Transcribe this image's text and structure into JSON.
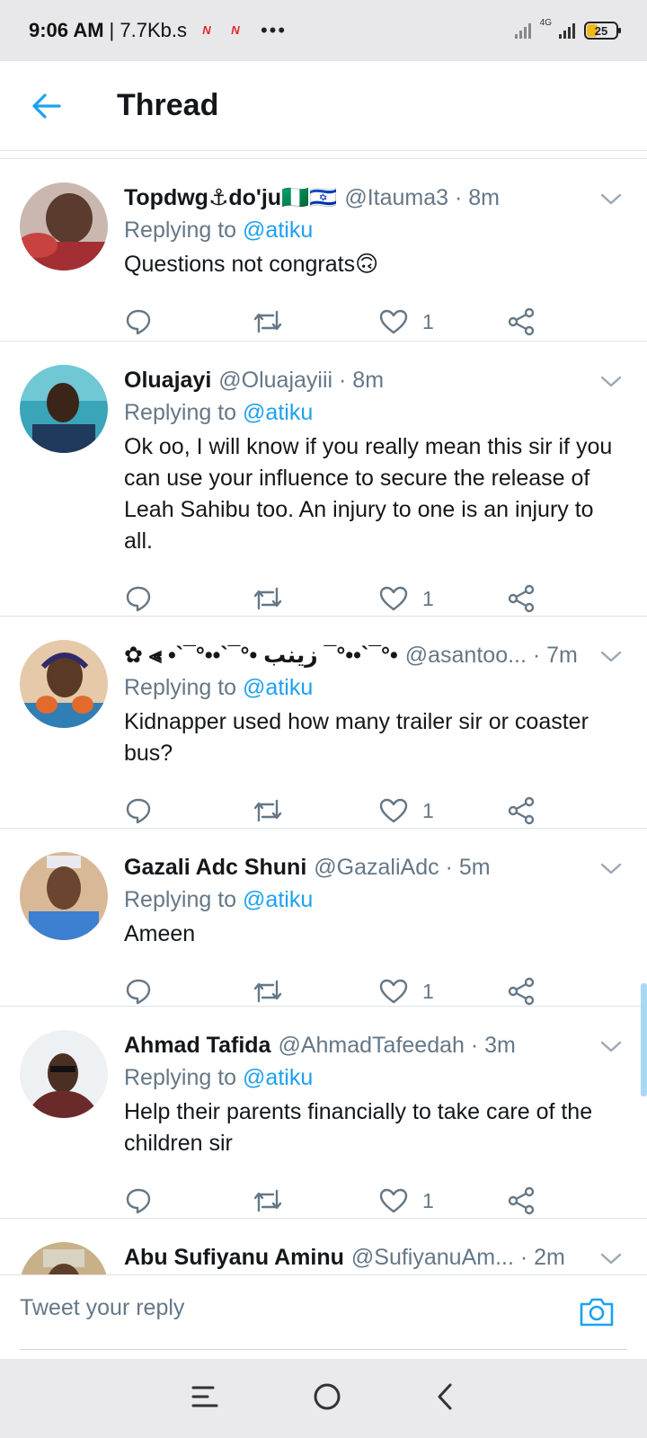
{
  "status_bar": {
    "time": "9:06 AM",
    "speed": "| 7.7Kb.s",
    "app_icons": [
      "N",
      "N"
    ],
    "dots": "•••",
    "network": "4G",
    "battery": "25"
  },
  "header": {
    "title": "Thread"
  },
  "tweets": [
    {
      "name": "Topdwg⚓do'ju🇳🇬🇮🇱",
      "meta": "@Itauma3 · 8m",
      "replying_prefix": "Replying to",
      "mention": "@atiku",
      "text": "Questions not congrats🙃",
      "likes": "1"
    },
    {
      "name": "Oluajayi",
      "meta": "@Oluajayiii · 8m",
      "replying_prefix": "Replying to",
      "mention": "@atiku",
      "text": "Ok oo, I will know if you really mean this sir if you can use your influence to secure the release of Leah Sahibu too. An injury to one is an injury to all.",
      "likes": "1"
    },
    {
      "name": "✿ ⫷ •`¯°••`¯°• زينب ¯°••`¯°•",
      "meta": "@asantoo... · 7m",
      "replying_prefix": "Replying to",
      "mention": "@atiku",
      "text": "Kidnapper used how many trailer sir or coaster bus?",
      "likes": "1"
    },
    {
      "name": "Gazali Adc Shuni",
      "meta": "@GazaliAdc · 5m",
      "replying_prefix": "Replying to",
      "mention": "@atiku",
      "text": "Ameen",
      "likes": "1"
    },
    {
      "name": "Ahmad Tafida",
      "meta": "@AhmadTafeedah · 3m",
      "replying_prefix": "Replying to",
      "mention": "@atiku",
      "text": "Help their parents financially to  take care of the children sir",
      "likes": "1"
    },
    {
      "name": "Abu Sufiyanu Aminu",
      "meta": "@SufiyanuAm... · 2m",
      "replying_prefix": "",
      "mention": "",
      "text": "",
      "likes": ""
    }
  ],
  "reply_bar": {
    "placeholder": "Tweet your reply"
  },
  "colors": {
    "accent": "#1da1f2",
    "muted": "#657786",
    "text": "#14171a",
    "divider": "#dfe3e6"
  }
}
